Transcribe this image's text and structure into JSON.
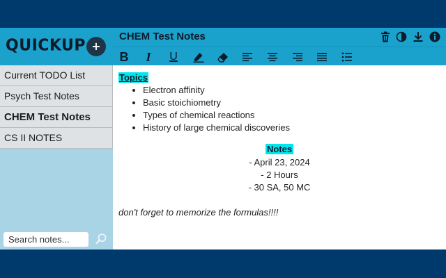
{
  "app": {
    "logo_text": "QUICKUP",
    "add_label": "+"
  },
  "sidebar": {
    "items": [
      {
        "label": "Current TODO List",
        "active": false
      },
      {
        "label": "Psych Test Notes",
        "active": false
      },
      {
        "label": "CHEM Test Notes",
        "active": true
      },
      {
        "label": "CS II NOTES",
        "active": false
      }
    ],
    "search_placeholder": "Search notes..."
  },
  "header": {
    "title": "CHEM Test Notes",
    "icons": [
      "trash-icon",
      "theme-contrast-icon",
      "download-icon",
      "info-icon"
    ]
  },
  "toolbar": {
    "bold": "B",
    "italic": "I",
    "underline": "U",
    "icons": [
      "bold-icon",
      "italic-icon",
      "underline-icon",
      "highlighter-icon",
      "eraser-icon",
      "align-left-icon",
      "align-center-icon",
      "align-right-icon",
      "align-justify-icon",
      "bullet-list-icon"
    ]
  },
  "editor": {
    "topics_heading": "Topics",
    "topics": [
      "Electron affinity",
      "Basic stoichiometry",
      "Types of chemical reactions",
      "History of large chemical discoveries"
    ],
    "notes_heading": "Notes",
    "notes_lines": [
      "- April 23, 2024",
      "- 2 Hours",
      "- 30 SA, 50 MC"
    ],
    "footer_line": "don't forget to memorize the formulas!!!!"
  },
  "colors": {
    "frame": "#00396b",
    "accent": "#1aa1cc",
    "sidebar_bg": "#a9d4e6",
    "highlight": "#00e5ee"
  }
}
